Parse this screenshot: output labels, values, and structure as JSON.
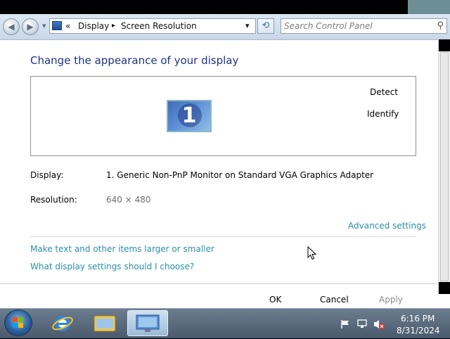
{
  "nav": {
    "back_glyph": "◀",
    "forward_glyph": "▶",
    "address": {
      "overflow": "«",
      "crumb1": "Display",
      "separator": "▸",
      "crumb2": "Screen Resolution",
      "dropdown_glyph": "▾"
    },
    "refresh_glyph": "⟲",
    "search_placeholder": "Search Control Panel"
  },
  "content": {
    "heading": "Change the appearance of your display",
    "monitor_number": "1",
    "detect_label": "Detect",
    "identify_label": "Identify",
    "display_label": "Display:",
    "display_value": "1. Generic Non-PnP Monitor on Standard VGA Graphics Adapter",
    "resolution_label": "Resolution:",
    "resolution_value": "640 × 480",
    "advanced_link": "Advanced settings",
    "link_text_size": "Make text and other items larger or smaller",
    "link_which_settings": "What display settings should I choose?"
  },
  "dialog": {
    "ok": "OK",
    "cancel": "Cancel",
    "apply": "Apply"
  },
  "taskbar": {
    "time": "6:16 PM",
    "date": "8/31/2024"
  },
  "colors": {
    "heading": "#1e3287",
    "link": "#2a8fa8",
    "taskbar": "#4a5a6c"
  }
}
